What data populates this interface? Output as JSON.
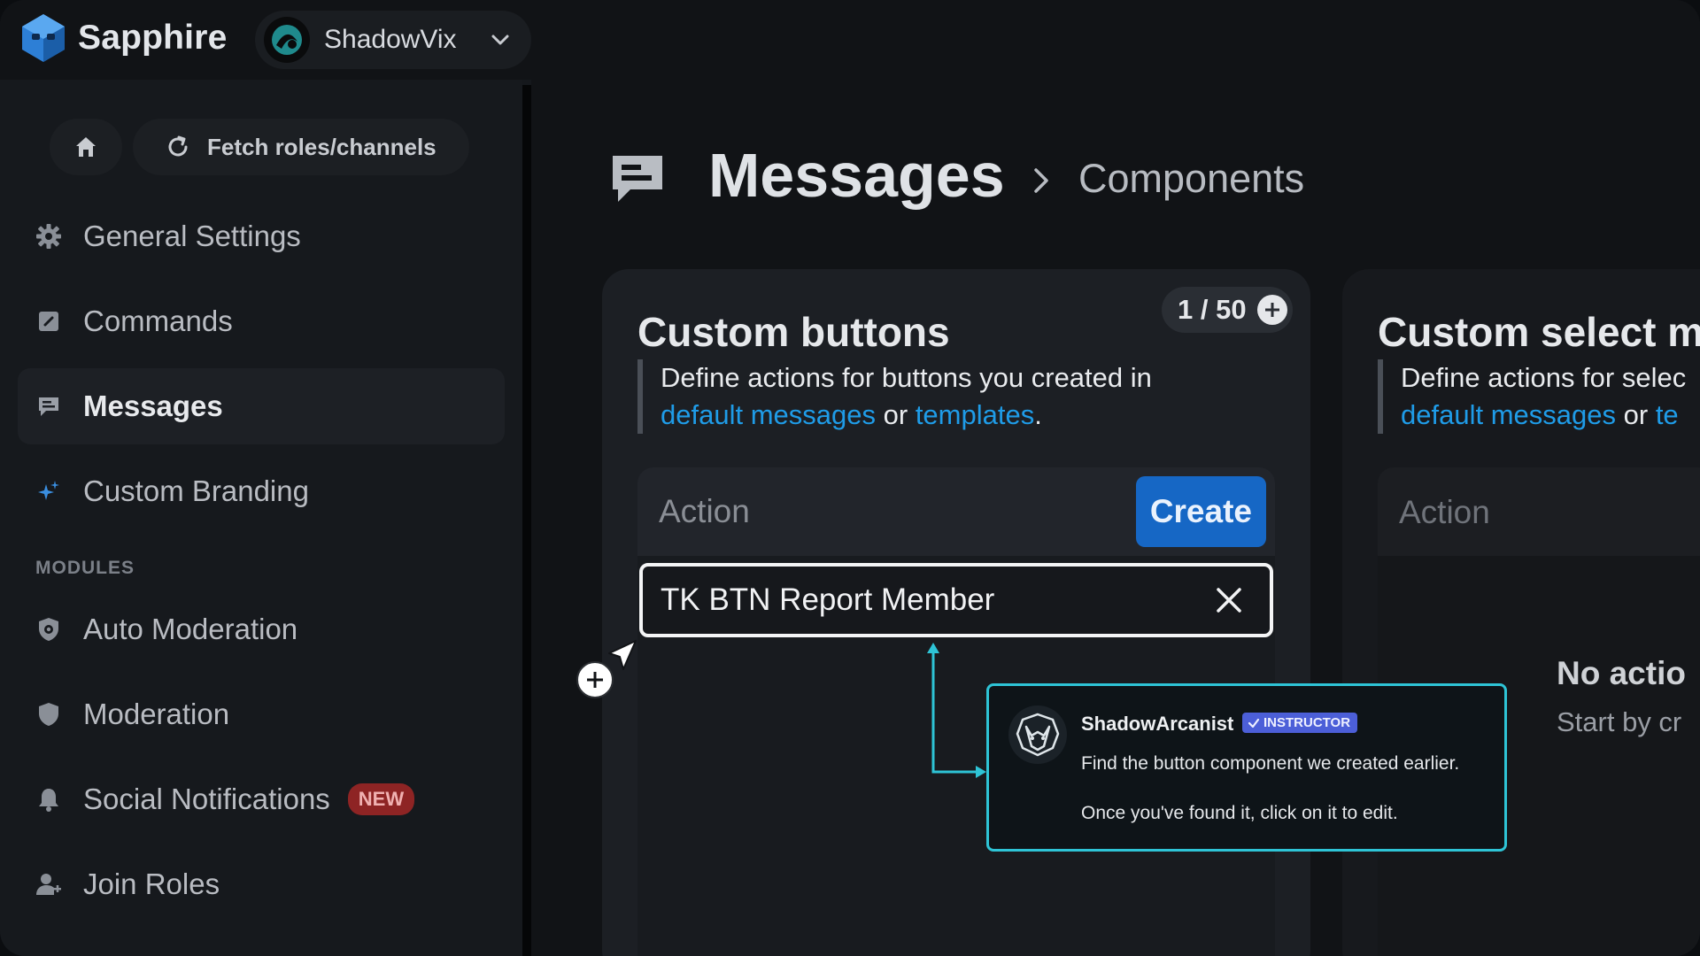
{
  "app": {
    "name": "Sapphire"
  },
  "server": {
    "name": "ShadowVix"
  },
  "toolbar": {
    "fetch_label": "Fetch roles/channels"
  },
  "sidebar": {
    "items": [
      {
        "label": "General Settings"
      },
      {
        "label": "Commands"
      },
      {
        "label": "Messages"
      },
      {
        "label": "Custom Branding"
      }
    ],
    "modules_label": "MODULES",
    "module_items": [
      {
        "label": "Auto Moderation"
      },
      {
        "label": "Moderation"
      },
      {
        "label": "Social Notifications",
        "badge": "NEW"
      },
      {
        "label": "Join Roles"
      }
    ]
  },
  "page": {
    "title": "Messages",
    "breadcrumb_current": "Components"
  },
  "buttons_card": {
    "title": "Custom buttons",
    "counter": "1 / 50",
    "desc_prefix": "Define actions for buttons you created in",
    "link_default": "default messages",
    "desc_or": "or",
    "link_templates": "templates",
    "desc_end": ".",
    "action_placeholder": "Action",
    "create_label": "Create",
    "items": [
      {
        "label": "TK BTN Report Member"
      }
    ]
  },
  "select_card": {
    "title": "Custom select m",
    "desc_prefix": "Define actions for selec",
    "link_default": "default messages",
    "desc_or": "or",
    "link_templates": "te",
    "action_placeholder": "Action",
    "empty_title": "No actio",
    "empty_sub": "Start by cr"
  },
  "tooltip": {
    "author": "ShadowArcanist",
    "badge": "INSTRUCTOR",
    "line1": "Find the button component we created earlier.",
    "line2": "Once you've found it, click on it to edit."
  },
  "colors": {
    "accent": "#1667c5",
    "link": "#1f9ce8",
    "tooltip_border": "#2ec4d6",
    "badge_new": "#8e2424"
  }
}
